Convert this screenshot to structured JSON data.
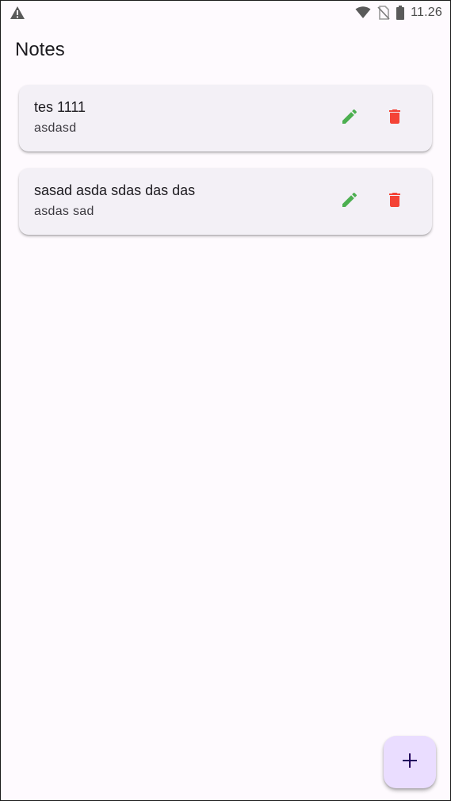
{
  "status_bar": {
    "time": "11.26",
    "left_icon": "alert-triangle-icon",
    "right_icons": [
      "wifi-icon",
      "no-sim-icon",
      "battery-icon"
    ]
  },
  "app_bar": {
    "title": "Notes"
  },
  "notes": [
    {
      "title": "tes 1111",
      "body": "asdasd"
    },
    {
      "title": "sasad asda sdas das das",
      "body": "asdas sad"
    }
  ],
  "actions": {
    "edit_icon": "pencil-icon",
    "delete_icon": "trash-icon",
    "add_icon": "plus-icon"
  },
  "colors": {
    "edit": "#4caf50",
    "delete": "#f44336",
    "fab_bg": "#eaddff",
    "card_bg": "#f3f0f6",
    "background": "#fefafe"
  }
}
